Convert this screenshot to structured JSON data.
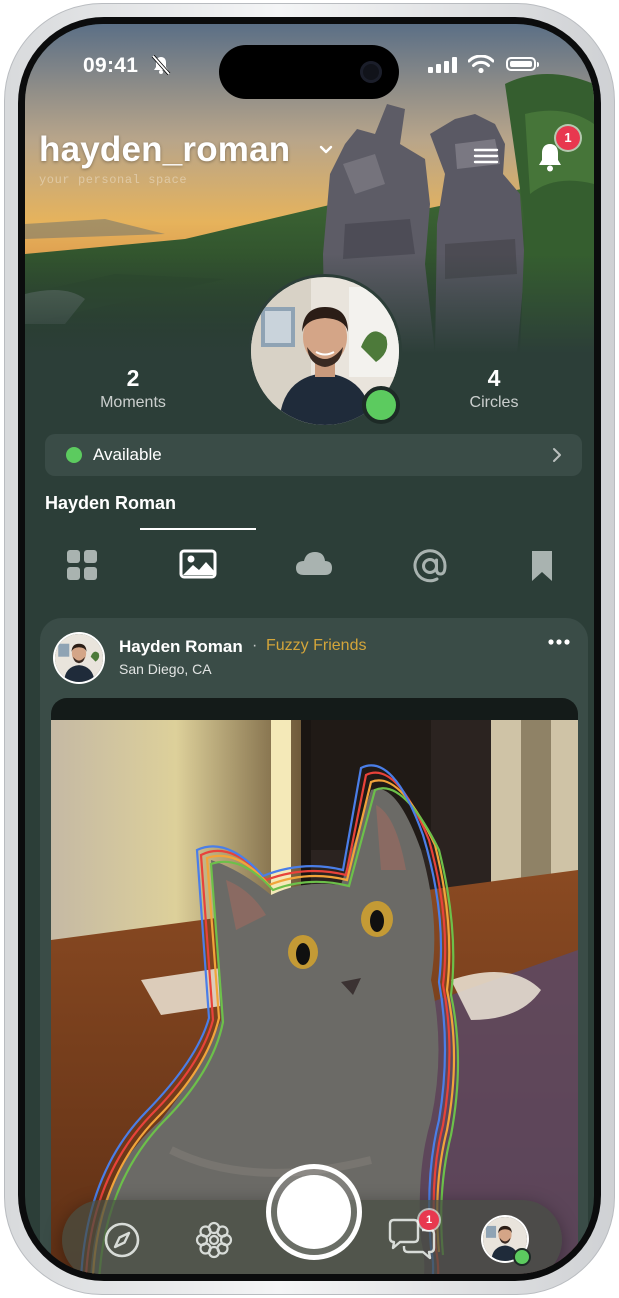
{
  "status_bar": {
    "time": "09:41"
  },
  "header": {
    "username": "hayden_roman",
    "tagline": "your personal space",
    "notification_count": "1"
  },
  "profile": {
    "moments_count": "2",
    "moments_label": "Moments",
    "circles_count": "4",
    "circles_label": "Circles",
    "availability": "Available",
    "full_name": "Hayden Roman"
  },
  "tabs": [
    {
      "icon": "grid-icon"
    },
    {
      "icon": "photo-icon",
      "selected": true
    },
    {
      "icon": "cloud-icon"
    },
    {
      "icon": "at-icon"
    },
    {
      "icon": "bookmark-icon"
    }
  ],
  "post": {
    "author": "Hayden Roman",
    "separator": "·",
    "circle": "Fuzzy Friends",
    "location": "San Diego, CA"
  },
  "bottom_nav": {
    "items": [
      "compass-icon",
      "flower-icon",
      "capture-button",
      "chat-icon",
      "profile-avatar"
    ],
    "chat_badge": "1"
  },
  "colors": {
    "background": "#2c3e38",
    "card": "#3a4c47",
    "accent_circle": "#d3a53a",
    "online": "#5ccb5f",
    "badge": "#e8384f"
  }
}
